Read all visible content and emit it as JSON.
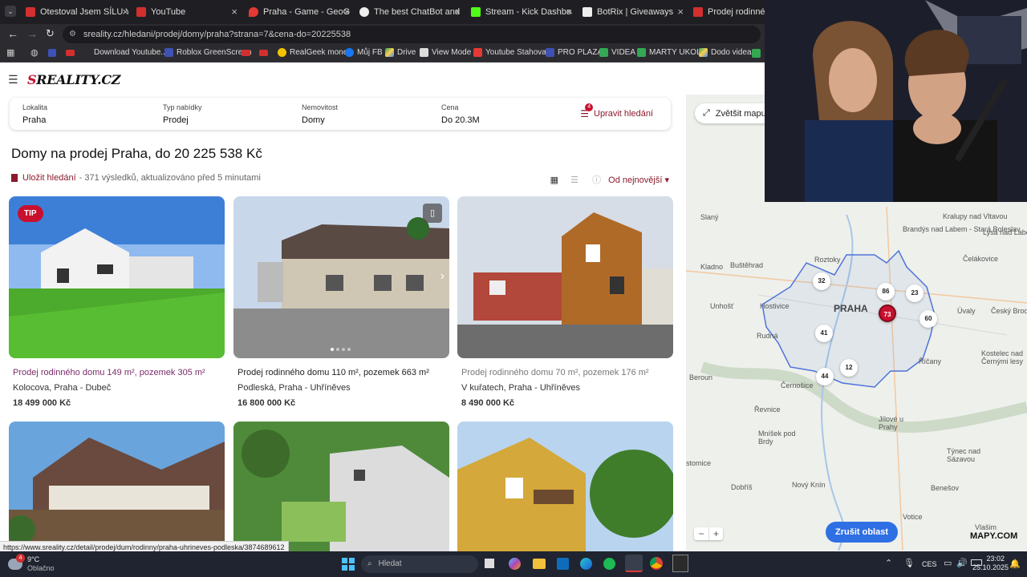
{
  "browser": {
    "tabs": [
      {
        "label": "Otestoval Jsem SÍLU YOU",
        "color": "#d32f2f"
      },
      {
        "label": "YouTube",
        "color": "#d32f2f"
      },
      {
        "label": "Praha - Game - GeoGuess",
        "color": "#e53935"
      },
      {
        "label": "The best ChatBot and Wr",
        "color": "#eeeeee"
      },
      {
        "label": "Stream - Kick Dashboard",
        "color": "#53fc18"
      },
      {
        "label": "BotRix | Giveaways",
        "color": "#eeeeee"
      },
      {
        "label": "Prodej rodinného do",
        "color": "#d32f2f"
      }
    ],
    "url": "sreality.cz/hledani/prodej/domy/praha?strana=7&cena-do=20225538",
    "bookmarks": [
      "Download Youtube...",
      "Roblox GreenScreen",
      "RealGeek money",
      "Můj FB",
      "Drive",
      "View Mode",
      "Youtube Stahovaní",
      "PRO PLAZA",
      "VIDEA",
      "MARTY UKOLY",
      "Dodo videa"
    ],
    "status_url": "https://www.sreality.cz/detail/prodej/dum/rodinny/praha-uhrineves-podleska/3874689612"
  },
  "site": {
    "logo_prefix": "S",
    "logo_main": "REALITY.CZ"
  },
  "filter": {
    "items": [
      {
        "label": "Lokalita",
        "value": "Praha"
      },
      {
        "label": "Typ nabídky",
        "value": "Prodej"
      },
      {
        "label": "Nemovitost",
        "value": "Domy"
      },
      {
        "label": "Cena",
        "value": "Do 20.3M"
      }
    ],
    "edit_label": "Upravit hledání",
    "edit_count": "4"
  },
  "page": {
    "title": "Domy na prodej Praha, do 20 225 538 Kč",
    "save_label": "Uložit hledání",
    "results_info": "- 371 výsledků, aktualizováno před 5 minutami",
    "sort_label": "Od nejnovější"
  },
  "listings": [
    {
      "title": "Prodej rodinného domu 149 m², pozemek 305 m²",
      "address": "Kolocova, Praha - Dubeč",
      "price": "18 499 000 Kč",
      "tip": "TIP"
    },
    {
      "title": "Prodej rodinného domu 110 m², pozemek 663 m²",
      "address": "Podleská, Praha - Uhříněves",
      "price": "16 800 000 Kč"
    },
    {
      "title": "Prodej rodinného domu 70 m², pozemek 176 m²",
      "address": "V kuřatech, Praha - Uhříněves",
      "price": "8 490 000 Kč"
    }
  ],
  "map": {
    "expand_label": "Zvětšit mapu",
    "cancel_area_label": "Zrušit oblast",
    "brand": "MAPY.COM",
    "places": [
      "Kralupy nad Vltavou",
      "Brandýs nad Labem - Stará Boleslav",
      "Lysá nad Labem",
      "Slaný",
      "Čelákovice",
      "Roztoky",
      "Kladno",
      "Buštěhrad",
      "PRAHA",
      "Úvaly",
      "Český Brod",
      "Unhošť",
      "Hostivice",
      "Rudná",
      "Beroun",
      "Černošice",
      "Říčany",
      "Kostelec nad Černými lesy",
      "Řevnice",
      "Jílové u Prahy",
      "Mníšek pod Brdy",
      "Týnec nad Sázavou",
      "Dobříš",
      "Nový Knín",
      "Benešov",
      "Vlašim",
      "Votice",
      "stomice"
    ],
    "clusters": [
      {
        "count": "32",
        "highlight": false
      },
      {
        "count": "86",
        "highlight": false
      },
      {
        "count": "23",
        "highlight": false
      },
      {
        "count": "73",
        "highlight": true
      },
      {
        "count": "60",
        "highlight": false
      },
      {
        "count": "41",
        "highlight": false
      },
      {
        "count": "12",
        "highlight": false
      },
      {
        "count": "44",
        "highlight": false
      }
    ],
    "zoom_out": "−",
    "zoom_in": "+"
  },
  "taskbar": {
    "weather_temp": "9°C",
    "weather_desc": "Oblačno",
    "weather_badge": "4",
    "search_placeholder": "Hledat",
    "lang": "CES",
    "time": "23:02",
    "date": "25.10.2025"
  },
  "colors": {
    "brand": "#c8102e",
    "accent": "#8b1a2c",
    "link_title": "#7a2b6a",
    "map_button": "#2f6fe4"
  }
}
